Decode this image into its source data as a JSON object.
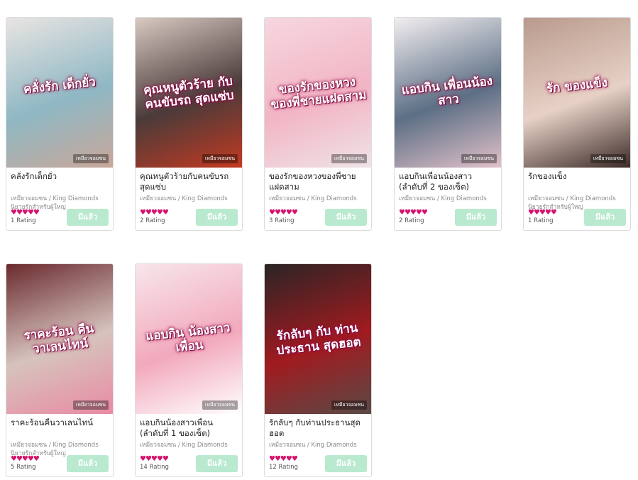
{
  "books": [
    {
      "title": "คลั่งรักเด็กยั่ว",
      "cover_text": "คลั่งรัก เด็กยั่ว",
      "cover_author": "เหมียวจอมซน",
      "author": "เหมียวจอมซน / King Diamonds",
      "tag": "นิยายรักสำหรับผู้ใหญ่",
      "hearts": "♥♥♥♥♥",
      "rating": "1 Rating",
      "button": "มีแล้ว",
      "cover_colors": [
        "#e9e4e2",
        "#8fb8c4",
        "#c9a79a"
      ]
    },
    {
      "title": "คุณหนูตัวร้ายกับคนขับรถสุดแซ่บ",
      "cover_text": "คุณหนูตัวร้าย กับคนขับรถ สุดแซ่บ",
      "cover_author": "เหมียวจอมซน",
      "author": "เหมียวจอมซน / King Diamonds",
      "tag": "",
      "hearts": "♥♥♥♥♥",
      "rating": "2 Rating",
      "button": "มีแล้ว",
      "cover_colors": [
        "#d8c9c2",
        "#4a3b3a",
        "#c23a22"
      ]
    },
    {
      "title": "ของรักของหวงของพี่ชายแฝดสาม",
      "cover_text": "ของรักของหวง ของพี่ชายแฝดสาม",
      "cover_author": "เหมียวจอมซน",
      "author": "เหมียวจอมซน / King Diamonds",
      "tag": "",
      "hearts": "♥♥♥♥♥",
      "rating": "3 Rating",
      "button": "มีแล้ว",
      "cover_colors": [
        "#f6d7df",
        "#f2b5c5",
        "#efe3e6"
      ]
    },
    {
      "title": "แอบกินเพื่อนน้องสาว (ลำดับที่ 2 ของเซ็ต)",
      "cover_text": "แอบกิน เพื่อนน้องสาว",
      "cover_author": "เหมียวจอมซน",
      "author": "เหมียวจอมซน / King Diamonds",
      "tag": "",
      "hearts": "♥♥♥♥♥",
      "rating": "2 Rating",
      "button": "มีแล้ว",
      "cover_colors": [
        "#f3eef0",
        "#5c6f85",
        "#e2c1c9"
      ]
    },
    {
      "title": "รักของแข็ง",
      "cover_text": "รัก ของแข็ง",
      "cover_author": "เหมียวจอมซน",
      "author": "เหมียวจอมซน / King Diamonds",
      "tag": "นิยายรักสำหรับผู้ใหญ่",
      "hearts": "♥♥♥♥♥",
      "rating": "1 Rating",
      "button": "มีแล้ว",
      "cover_colors": [
        "#b99a8d",
        "#e7d1c6",
        "#3c2b27"
      ]
    },
    {
      "title": "ราคะร้อนคืนวาเลนไทน์",
      "cover_text": "ราคะร้อน คืน วาเลนไทน์",
      "cover_author": "เหมียวจอมซน",
      "author": "เหมียวจอมซน / King Diamonds",
      "tag": "นิยายรักสำหรับผู้ใหญ่",
      "hearts": "♥♥♥♥♥",
      "rating": "5 Rating",
      "button": "มีแล้ว",
      "cover_colors": [
        "#6a2a2e",
        "#d6c3bd",
        "#e98aa3"
      ]
    },
    {
      "title": "แอบกินน้องสาวเพื่อน (ลำดับที่ 1 ของเซ็ต)",
      "cover_text": "แอบกิน น้องสาว เพื่อน",
      "cover_author": "เหมียวจอมซน",
      "author": "เหมียวจอมซน / King Diamonds",
      "tag": "",
      "hearts": "♥♥♥♥♥",
      "rating": "14 Rating",
      "button": "มีแล้ว",
      "cover_colors": [
        "#f7e6ea",
        "#f2a9bd",
        "#ffffff"
      ]
    },
    {
      "title": "รักลับๆ กับท่านประธานสุดฮอต",
      "cover_text": "รักลับๆ กับ ท่านประธาน สุดฮอต",
      "cover_author": "เหมียวจอมซน",
      "author": "เหมียวจอมซน / King Diamonds",
      "tag": "",
      "hearts": "♥♥♥♥♥",
      "rating": "12 Rating",
      "button": "มีแล้ว",
      "cover_colors": [
        "#2b2425",
        "#a01b1f",
        "#5a4a47"
      ]
    }
  ]
}
